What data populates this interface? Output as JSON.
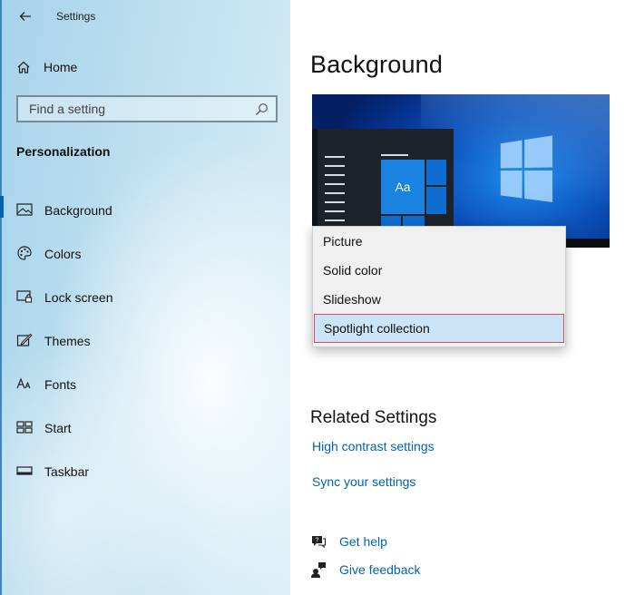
{
  "window": {
    "title": "Settings"
  },
  "sidebar": {
    "home_label": "Home",
    "search_placeholder": "Find a setting",
    "section_header": "Personalization",
    "items": [
      {
        "label": "Background",
        "icon": "picture-icon",
        "active": true
      },
      {
        "label": "Colors",
        "icon": "palette-icon"
      },
      {
        "label": "Lock screen",
        "icon": "lock-screen-icon"
      },
      {
        "label": "Themes",
        "icon": "themes-icon"
      },
      {
        "label": "Fonts",
        "icon": "fonts-icon"
      },
      {
        "label": "Start",
        "icon": "start-icon"
      },
      {
        "label": "Taskbar",
        "icon": "taskbar-icon"
      }
    ]
  },
  "main": {
    "title": "Background",
    "preview_tile_label": "Aa",
    "dropdown": {
      "options": [
        "Picture",
        "Solid color",
        "Slideshow",
        "Spotlight collection"
      ],
      "selected": "Spotlight collection"
    },
    "related": {
      "title": "Related Settings",
      "links": [
        "High contrast settings",
        "Sync your settings"
      ]
    },
    "help": {
      "get_help": "Get help",
      "give_feedback": "Give feedback"
    }
  },
  "colors": {
    "accent": "#0063b1",
    "link": "#0063b1",
    "selection_fill": "#cce4f7",
    "selection_border": "#d05060"
  }
}
